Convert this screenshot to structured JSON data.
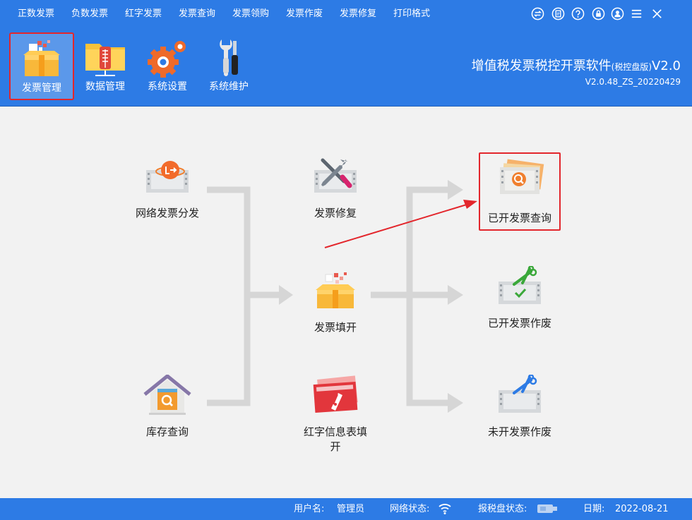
{
  "menu": {
    "items": [
      "正数发票",
      "负数发票",
      "红字发票",
      "发票查询",
      "发票领购",
      "发票作废",
      "发票修复",
      "打印格式"
    ]
  },
  "window_controls": [
    "switch-icon",
    "clipboard-icon",
    "help-icon",
    "lock-icon",
    "user-icon",
    "menu-icon",
    "close-icon"
  ],
  "toolbar": {
    "items": [
      {
        "label": "发票管理",
        "icon": "invoice-box-icon",
        "active": true
      },
      {
        "label": "数据管理",
        "icon": "data-folder-icon",
        "active": false
      },
      {
        "label": "系统设置",
        "icon": "gear-icon",
        "active": false
      },
      {
        "label": "系统维护",
        "icon": "tools-icon",
        "active": false
      }
    ]
  },
  "app": {
    "title": "增值税发票税控开票软件",
    "edition": "(税控盘版)",
    "version_short": "V2.0",
    "build": "V2.0.48_ZS_20220429"
  },
  "flow": {
    "network_distribute": "网络发票分发",
    "invoice_repair": "发票修复",
    "issued_query": "已开发票查询",
    "invoice_fill": "发票填开",
    "issued_void": "已开发票作废",
    "inventory_query": "库存查询",
    "red_info_fill": "红字信息表填开",
    "blank_void": "未开发票作废"
  },
  "status": {
    "user_label": "用户名:",
    "user_value": "管理员",
    "network_label": "网络状态:",
    "disk_label": "报税盘状态:",
    "date_label": "日期:",
    "date_value": "2022-08-21"
  },
  "colors": {
    "brand_blue": "#2d7be5",
    "highlight_red": "#e3262c",
    "background": "#f2f2f2"
  }
}
